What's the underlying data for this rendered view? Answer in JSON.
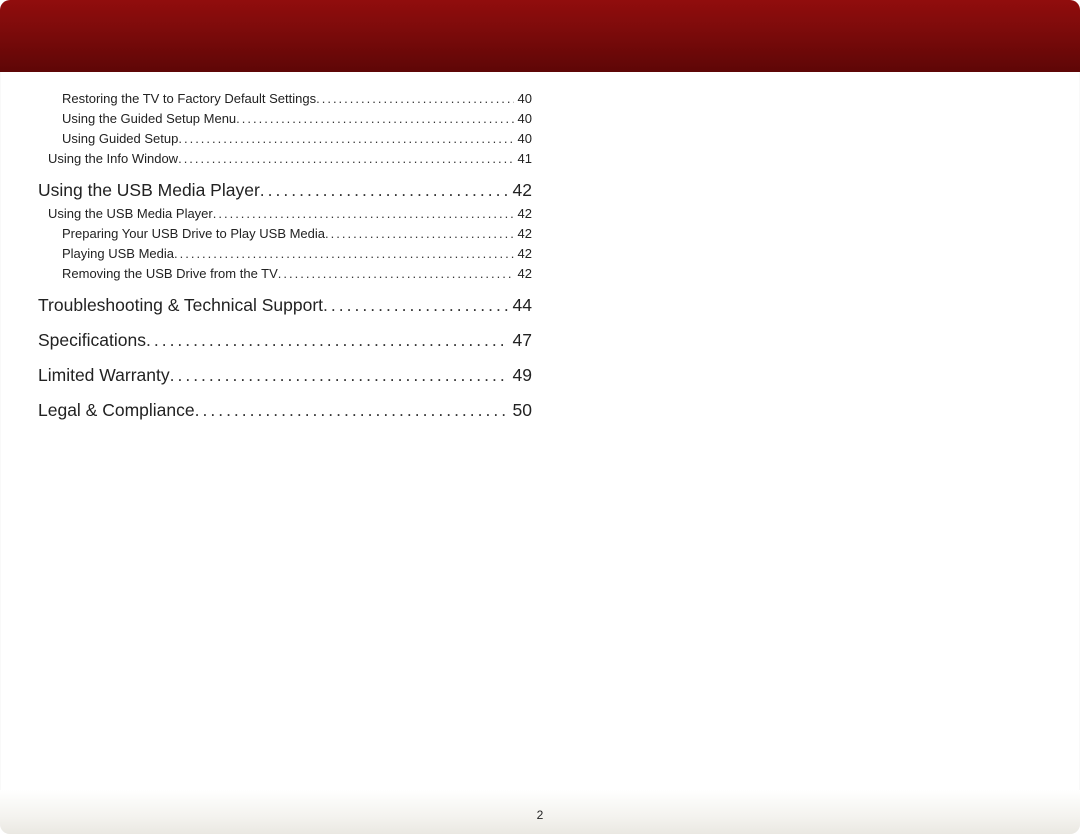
{
  "page_number": "2",
  "toc": [
    {
      "level": 3,
      "title": "Restoring the TV to Factory Default Settings",
      "page": "40"
    },
    {
      "level": 3,
      "title": "Using the Guided Setup Menu",
      "page": "40"
    },
    {
      "level": 3,
      "title": "Using Guided Setup",
      "page": "40"
    },
    {
      "level": 2,
      "title": "Using the Info Window",
      "page": "41"
    },
    {
      "level": 1,
      "title": "Using the USB Media Player",
      "page": "42"
    },
    {
      "level": 2,
      "title": "Using the USB Media Player",
      "page": "42"
    },
    {
      "level": 3,
      "title": "Preparing Your USB Drive to Play USB Media",
      "page": "42"
    },
    {
      "level": 3,
      "title": "Playing USB Media",
      "page": "42"
    },
    {
      "level": 3,
      "title": "Removing the USB Drive from the TV",
      "page": "42"
    },
    {
      "level": 1,
      "title": "Troubleshooting & Technical Support",
      "page": "44"
    },
    {
      "level": 1,
      "title": "Specifications",
      "page": "47"
    },
    {
      "level": 1,
      "title": "Limited Warranty",
      "page": "49"
    },
    {
      "level": 1,
      "title": "Legal & Compliance",
      "page": "50"
    }
  ]
}
